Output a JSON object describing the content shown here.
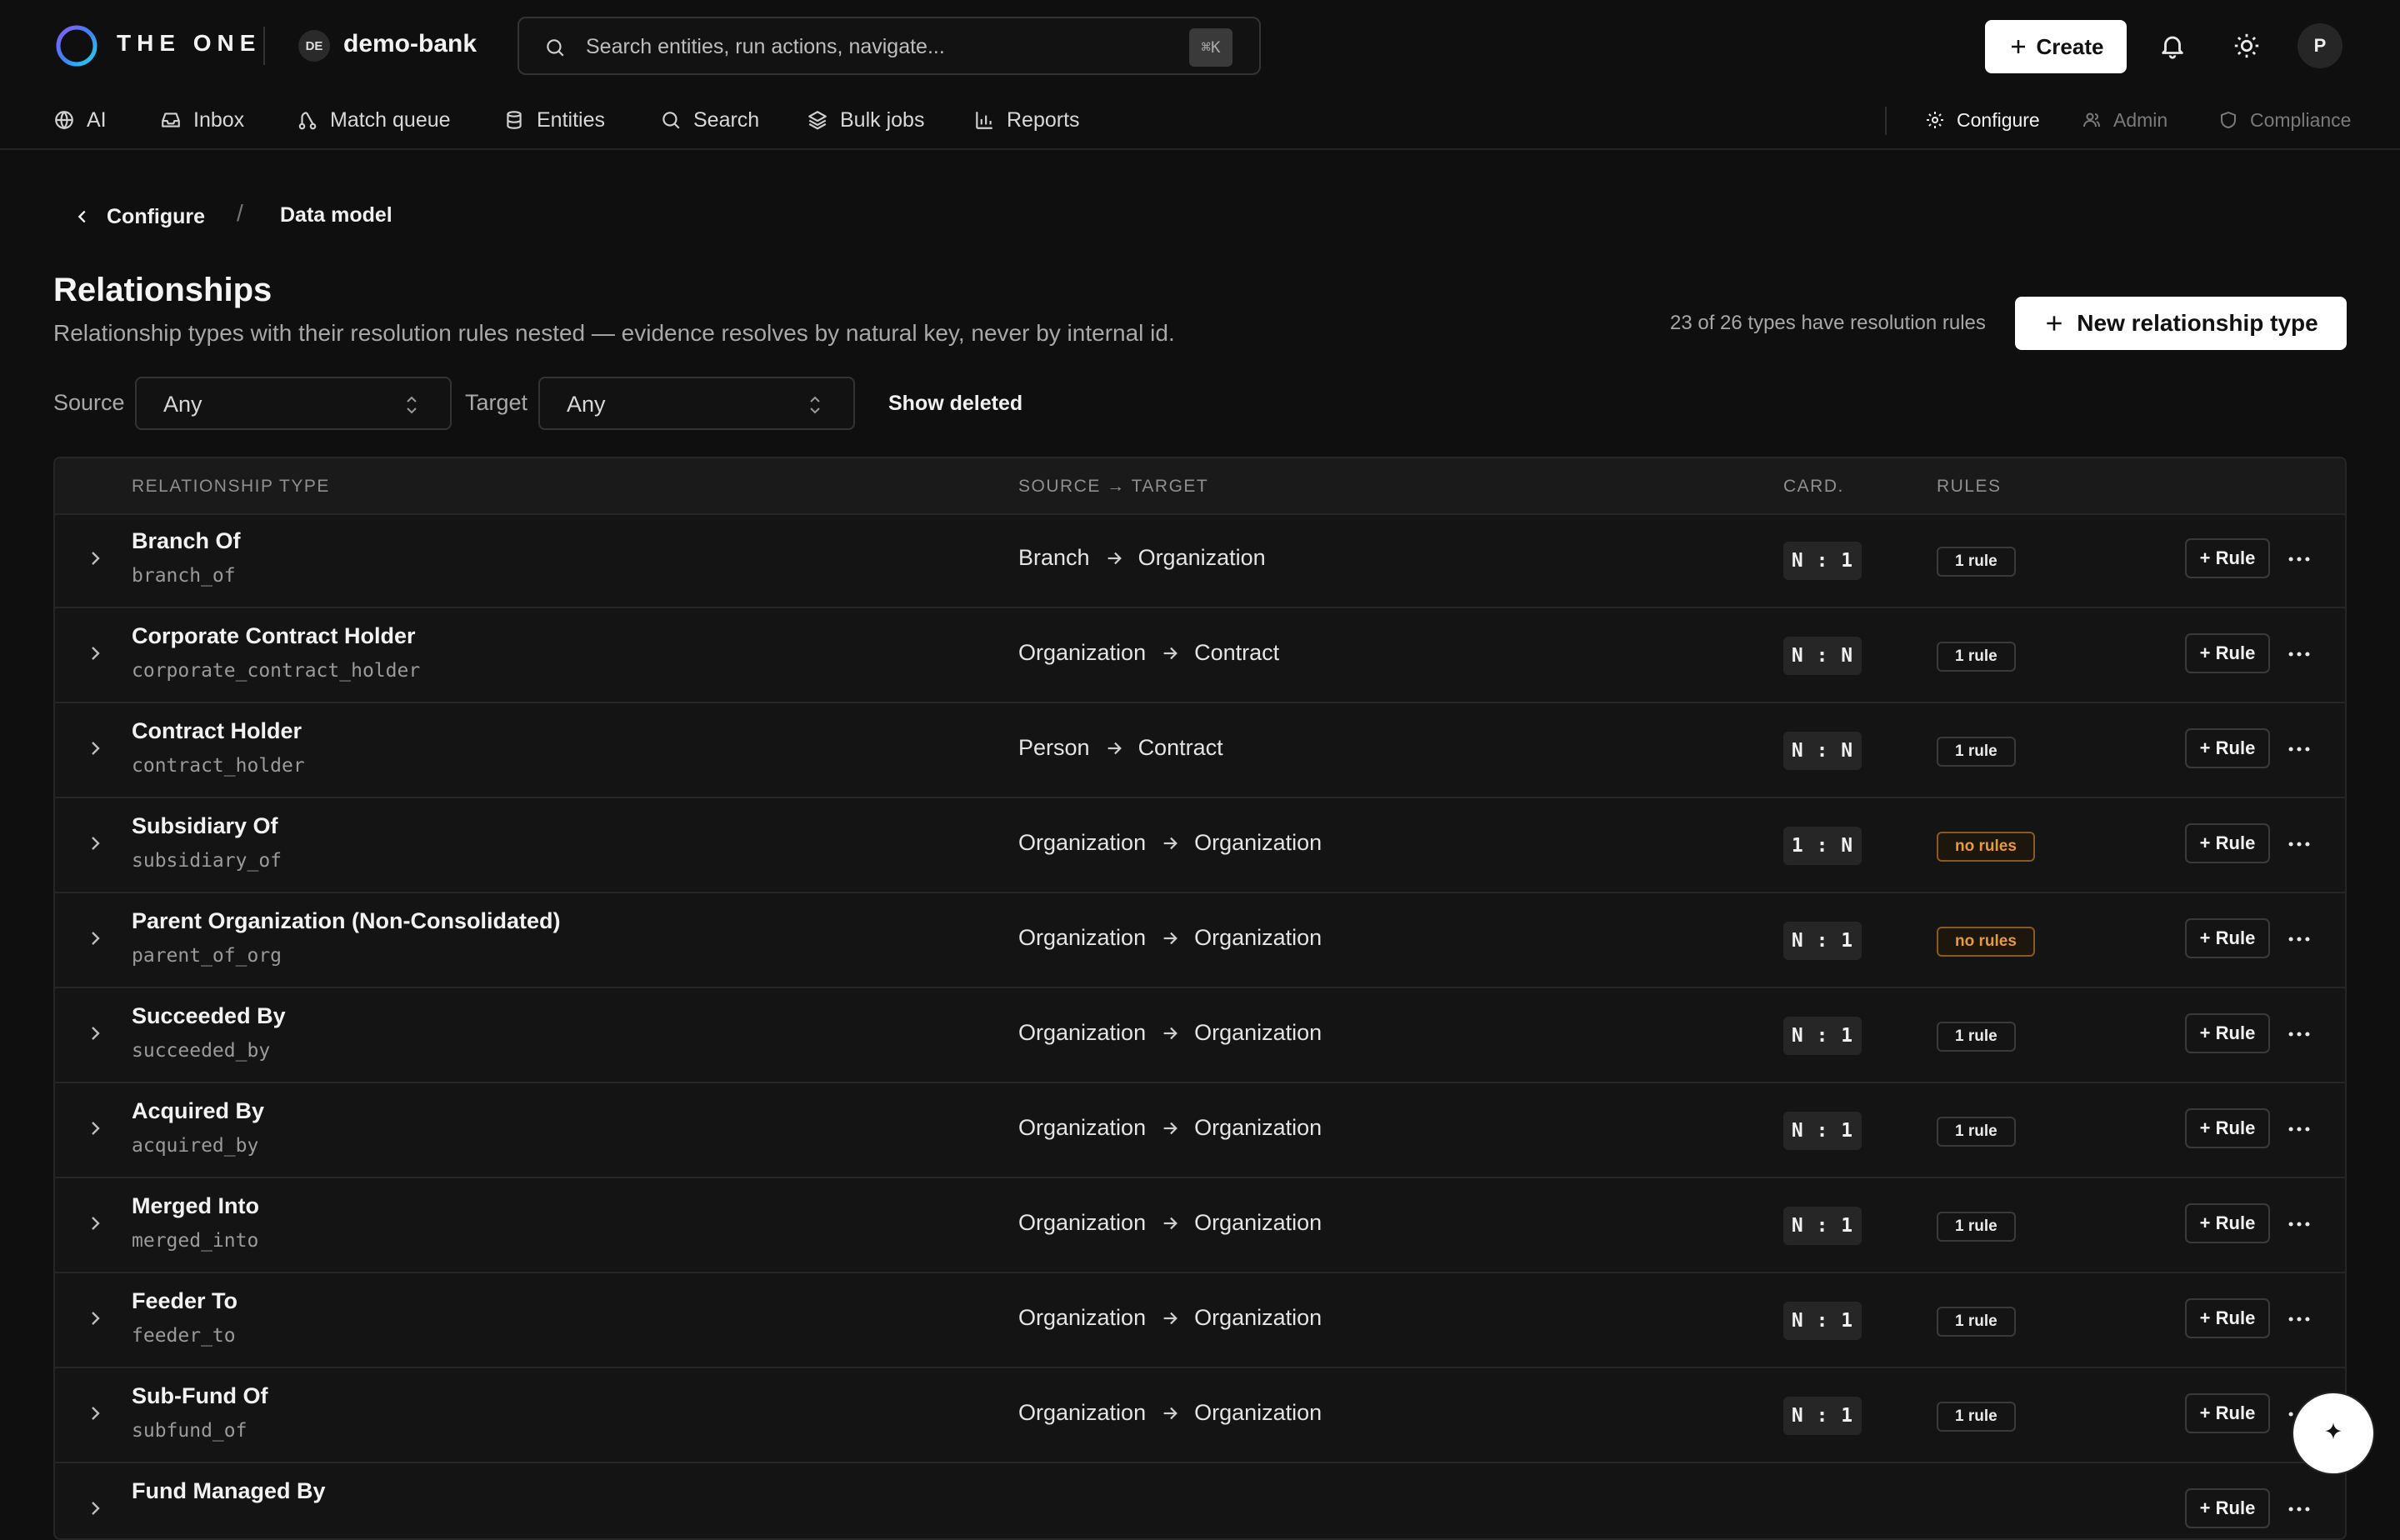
{
  "app": {
    "brand": "THE ONE",
    "workspace_initials": "DE",
    "workspace_name": "demo-bank",
    "search_placeholder": "Search entities, run actions, navigate...",
    "search_shortcut": "⌘K",
    "create_label": "Create",
    "user_initial": "P"
  },
  "nav": {
    "items": [
      {
        "label": "AI",
        "icon": "globe-icon"
      },
      {
        "label": "Inbox",
        "icon": "inbox-icon"
      },
      {
        "label": "Match queue",
        "icon": "route-icon"
      },
      {
        "label": "Entities",
        "icon": "database-icon"
      },
      {
        "label": "Search",
        "icon": "search-icon"
      },
      {
        "label": "Bulk jobs",
        "icon": "layers-icon"
      },
      {
        "label": "Reports",
        "icon": "bar-chart-icon"
      }
    ],
    "right": [
      {
        "label": "Configure",
        "icon": "gear-icon",
        "active": true
      },
      {
        "label": "Admin",
        "icon": "users-icon",
        "active": false
      },
      {
        "label": "Compliance",
        "icon": "shield-icon",
        "active": false
      }
    ]
  },
  "breadcrumb": {
    "back": "Configure",
    "separator": "/",
    "current": "Data model"
  },
  "page": {
    "title": "Relationships",
    "subtitle": "Relationship types with their resolution rules nested — evidence resolves by natural key, never by internal id.",
    "rules_summary": "23 of 26 types  have resolution rules",
    "new_button": "New relationship type"
  },
  "filters": {
    "source_label": "Source",
    "source_value": "Any",
    "target_label": "Target",
    "target_value": "Any",
    "show_deleted": "Show deleted"
  },
  "table": {
    "headers": {
      "type": "RELATIONSHIP TYPE",
      "source_target": "SOURCE → TARGET",
      "card": "CARD.",
      "rules": "RULES"
    },
    "add_rule_label": "+ Rule",
    "rows": [
      {
        "name": "Branch Of",
        "key": "branch_of",
        "source": "Branch",
        "target": "Organization",
        "card": "N : 1",
        "rules": "1 rule",
        "warn": false
      },
      {
        "name": "Corporate Contract Holder",
        "key": "corporate_contract_holder",
        "source": "Organization",
        "target": "Contract",
        "card": "N : N",
        "rules": "1 rule",
        "warn": false
      },
      {
        "name": "Contract Holder",
        "key": "contract_holder",
        "source": "Person",
        "target": "Contract",
        "card": "N : N",
        "rules": "1 rule",
        "warn": false
      },
      {
        "name": "Subsidiary Of",
        "key": "subsidiary_of",
        "source": "Organization",
        "target": "Organization",
        "card": "1 : N",
        "rules": "no rules",
        "warn": true
      },
      {
        "name": "Parent Organization (Non-Consolidated)",
        "key": "parent_of_org",
        "source": "Organization",
        "target": "Organization",
        "card": "N : 1",
        "rules": "no rules",
        "warn": true
      },
      {
        "name": "Succeeded By",
        "key": "succeeded_by",
        "source": "Organization",
        "target": "Organization",
        "card": "N : 1",
        "rules": "1 rule",
        "warn": false
      },
      {
        "name": "Acquired By",
        "key": "acquired_by",
        "source": "Organization",
        "target": "Organization",
        "card": "N : 1",
        "rules": "1 rule",
        "warn": false
      },
      {
        "name": "Merged Into",
        "key": "merged_into",
        "source": "Organization",
        "target": "Organization",
        "card": "N : 1",
        "rules": "1 rule",
        "warn": false
      },
      {
        "name": "Feeder To",
        "key": "feeder_to",
        "source": "Organization",
        "target": "Organization",
        "card": "N : 1",
        "rules": "1 rule",
        "warn": false
      },
      {
        "name": "Sub-Fund Of",
        "key": "subfund_of",
        "source": "Organization",
        "target": "Organization",
        "card": "N : 1",
        "rules": "1 rule",
        "warn": false
      },
      {
        "name": "Fund Managed By",
        "key": "",
        "source": "",
        "target": "",
        "card": "",
        "rules": "",
        "warn": false
      }
    ]
  },
  "colors": {
    "background": "#0f0f0f",
    "warning": "#e69a3a",
    "accent_gradient": [
      "#7c3aed",
      "#06b6d4"
    ]
  }
}
